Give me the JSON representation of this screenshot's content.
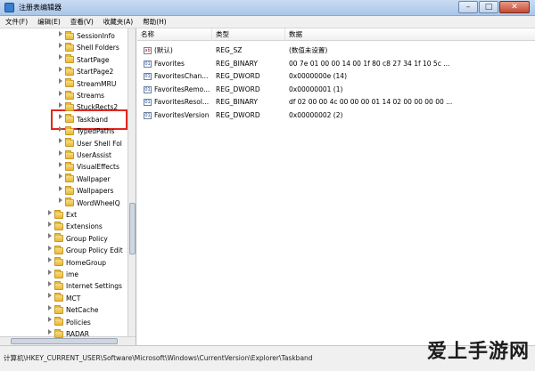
{
  "window": {
    "title": "注册表编辑器",
    "min": "–",
    "max": "□",
    "close": "✕"
  },
  "menu": [
    "文件(F)",
    "编辑(E)",
    "查看(V)",
    "收藏夹(A)",
    "帮助(H)"
  ],
  "tree": {
    "nodes": [
      {
        "label": "SessionInfo",
        "level": 2
      },
      {
        "label": "Shell Folders",
        "level": 2
      },
      {
        "label": "StartPage",
        "level": 2
      },
      {
        "label": "StartPage2",
        "level": 2
      },
      {
        "label": "StreamMRU",
        "level": 2
      },
      {
        "label": "Streams",
        "level": 2
      },
      {
        "label": "StuckRects2",
        "level": 2
      },
      {
        "label": "Taskband",
        "level": 2
      },
      {
        "label": "TypedPaths",
        "level": 2
      },
      {
        "label": "User Shell Fol",
        "level": 2
      },
      {
        "label": "UserAssist",
        "level": 2
      },
      {
        "label": "VisualEffects",
        "level": 2
      },
      {
        "label": "Wallpaper",
        "level": 2
      },
      {
        "label": "Wallpapers",
        "level": 2
      },
      {
        "label": "WordWheelQ",
        "level": 2
      },
      {
        "label": "Ext",
        "level": 1
      },
      {
        "label": "Extensions",
        "level": 1
      },
      {
        "label": "Group Policy",
        "level": 1
      },
      {
        "label": "Group Policy Edit",
        "level": 1
      },
      {
        "label": "HomeGroup",
        "level": 1
      },
      {
        "label": "ime",
        "level": 1
      },
      {
        "label": "Internet Settings",
        "level": 1
      },
      {
        "label": "MCT",
        "level": 1
      },
      {
        "label": "NetCache",
        "level": 1
      },
      {
        "label": "Policies",
        "level": 1
      },
      {
        "label": "RADAR",
        "level": 1
      }
    ]
  },
  "table": {
    "headers": [
      "名称",
      "类型",
      "数据"
    ],
    "rows": [
      {
        "icon": "ab",
        "name": "(默认)",
        "type": "REG_SZ",
        "data": "(数值未设置)"
      },
      {
        "icon": "01",
        "name": "Favorites",
        "type": "REG_BINARY",
        "data": "00 7e 01 00 00 14 00 1f 80 c8 27 34 1f 10 5c ..."
      },
      {
        "icon": "01",
        "name": "FavoritesChan...",
        "type": "REG_DWORD",
        "data": "0x0000000e (14)"
      },
      {
        "icon": "01",
        "name": "FavoritesRemo...",
        "type": "REG_DWORD",
        "data": "0x00000001 (1)"
      },
      {
        "icon": "01",
        "name": "FavoritesResol...",
        "type": "REG_BINARY",
        "data": "df 02 00 00 4c 00 00 00 01 14 02 00 00 00 00 ..."
      },
      {
        "icon": "01",
        "name": "FavoritesVersion",
        "type": "REG_DWORD",
        "data": "0x00000002 (2)"
      }
    ]
  },
  "status": {
    "path": "计算机\\HKEY_CURRENT_USER\\Software\\Microsoft\\Windows\\CurrentVersion\\Explorer\\Taskband"
  },
  "watermark": "爱上手游网"
}
